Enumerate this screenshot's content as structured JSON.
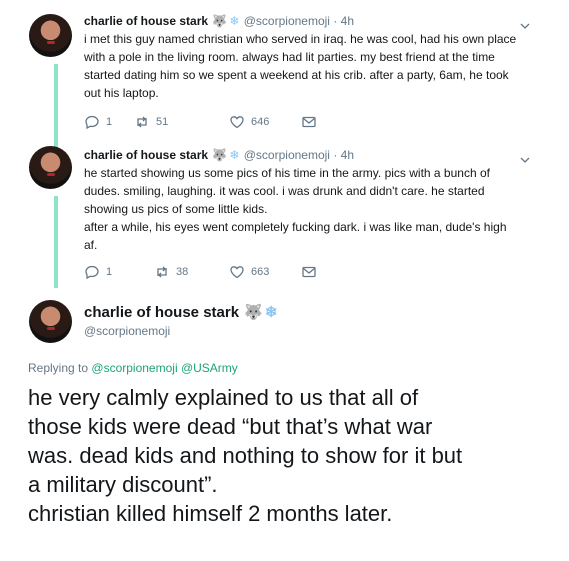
{
  "tweets": [
    {
      "name": "charlie of house stark",
      "handle": "@scorpionemoji",
      "time": "4h",
      "emoji_wolf": "🐺",
      "emoji_snow": "❄",
      "lines": [
        "i met this guy named christian who served in iraq. he was cool, had his own place",
        "with a pole in the living room. always had lit parties. my best friend at the time",
        "started dating him so we spent a weekend at his crib. after a party, 6am, he took",
        "out his laptop."
      ],
      "replies": "1",
      "retweets": "51",
      "likes": "646"
    },
    {
      "name": "charlie of house stark",
      "handle": "@scorpionemoji",
      "time": "4h",
      "emoji_wolf": "🐺",
      "emoji_snow": "❄",
      "lines": [
        "he started showing us some pics of his time in the army. pics with a bunch of",
        "dudes. smiling, laughing. it was cool. i was drunk and didn't care. he started",
        "showing us pics of some little kids.",
        "after a while, his eyes went completely fucking dark. i was like man, dude's high",
        "af."
      ],
      "replies": "1",
      "retweets": "38",
      "likes": "663"
    }
  ],
  "main": {
    "name": "charlie of house stark",
    "emoji_wolf": "🐺",
    "emoji_snow": "❄",
    "handle": "@scorpionemoji",
    "replying_label": "Replying to",
    "replying_to_1": "@scorpionemoji",
    "replying_to_2": "@USArmy",
    "lines": [
      "he very calmly explained to us that all of",
      "those kids were dead “but that’s what war",
      "was. dead kids and nothing to show for it but",
      "a military discount”.",
      "christian killed himself 2 months later."
    ]
  },
  "colors": {
    "thread_line": "#8fe3c8",
    "link": "#1ca37b",
    "muted": "#657786"
  },
  "dot": "·"
}
